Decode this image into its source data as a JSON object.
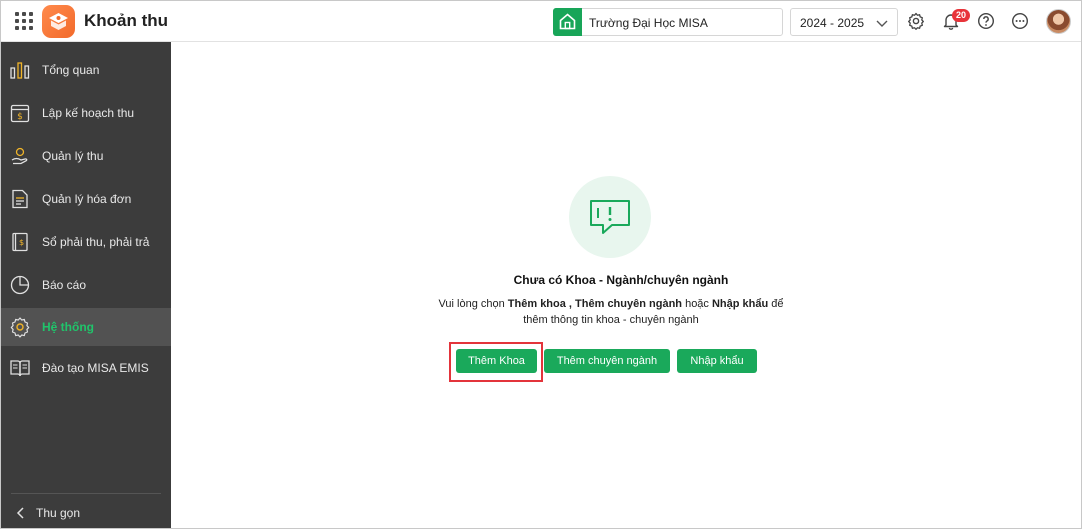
{
  "header": {
    "app_title": "Khoản thu",
    "school_name": "Trường Đại Học MISA",
    "school_year": "2024 - 2025",
    "notification_count": "20",
    "icons": [
      "apps-grid-icon",
      "app-logo-icon",
      "home-icon",
      "chevron-down-icon",
      "gear-icon",
      "bell-icon",
      "help-icon",
      "more-icon",
      "avatar"
    ]
  },
  "sidebar": {
    "items": [
      {
        "label": "Tổng quan",
        "icon": "bar-chart-icon"
      },
      {
        "label": "Lập kế hoạch thu",
        "icon": "calendar-money-icon"
      },
      {
        "label": "Quản lý thu",
        "icon": "hand-coin-icon"
      },
      {
        "label": "Quản lý hóa đơn",
        "icon": "invoice-icon"
      },
      {
        "label": "Sổ phải thu, phải trả",
        "icon": "ledger-icon"
      },
      {
        "label": "Báo cáo",
        "icon": "pie-chart-icon"
      },
      {
        "label": "Hệ thống",
        "icon": "gear-icon",
        "active": true
      },
      {
        "label": "Đào tạo MISA EMIS",
        "icon": "book-icon"
      }
    ],
    "collapse_label": "Thu gọn"
  },
  "main": {
    "empty_title": "Chưa có Khoa - Ngành/chuyên ngành",
    "desc_prefix": "Vui lòng chọn ",
    "desc_bold_1": "Thêm khoa",
    "desc_sep": " , ",
    "desc_bold_2": "Thêm chuyên ngành",
    "desc_mid": " hoặc ",
    "desc_bold_3": "Nhập khẩu",
    "desc_suffix": " để thêm thông tin khoa - chuyên ngành",
    "buttons": {
      "add_faculty": "Thêm Khoa",
      "add_major": "Thêm chuyên ngành",
      "import": "Nhập khẩu"
    }
  },
  "colors": {
    "primary": "#1aa95b",
    "sidebar_bg": "#3c3c3c",
    "active_text": "#20c46b",
    "highlight": "#e3343b",
    "badge": "#e8343a"
  }
}
